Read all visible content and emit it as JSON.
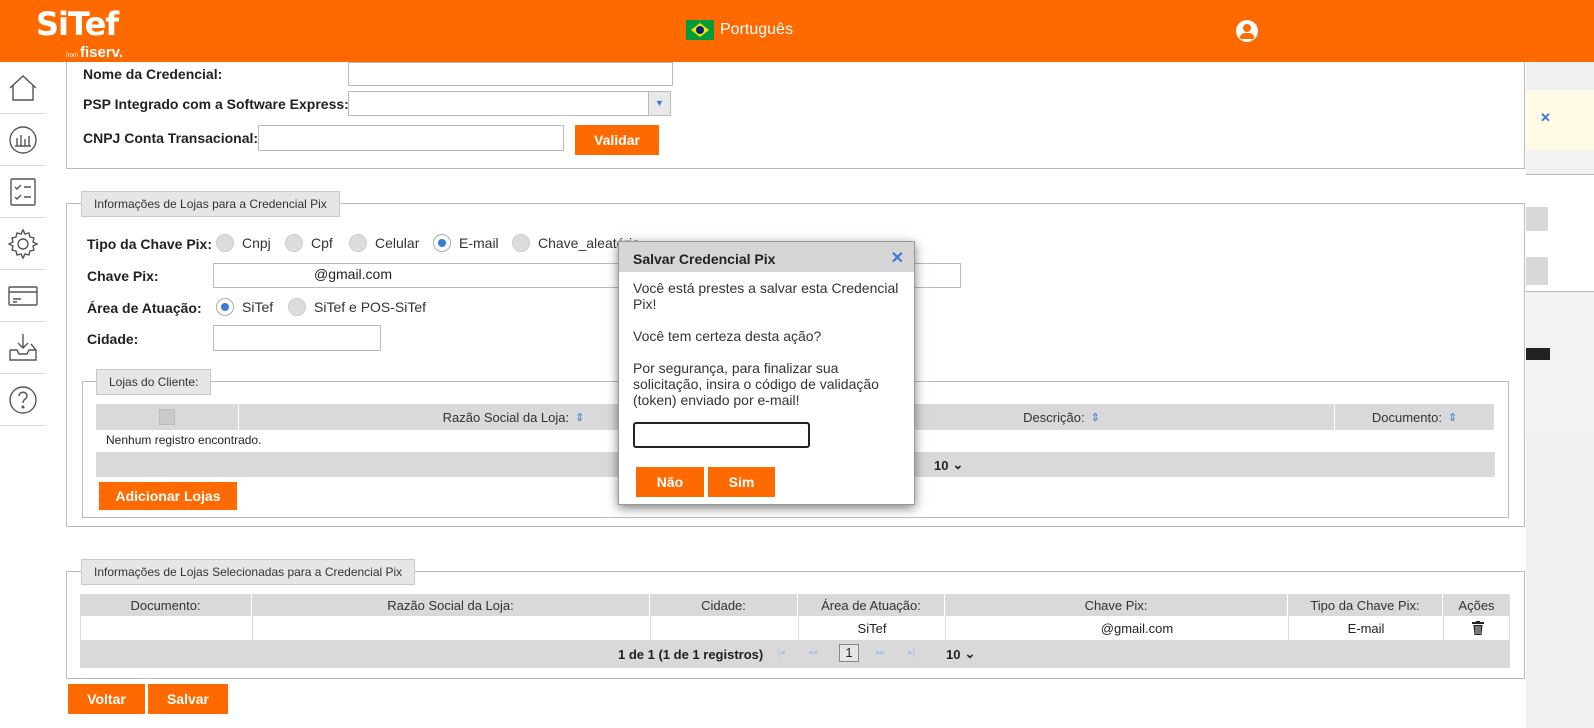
{
  "header": {
    "brand": "SiTef",
    "brand_from": "from",
    "brand_company": "fiserv.",
    "language": "Português"
  },
  "sidebar": {
    "items": [
      "home-icon",
      "chart-icon",
      "checklist-icon",
      "gear-icon",
      "card-icon",
      "download-icon",
      "help-icon"
    ]
  },
  "credential": {
    "name_label": "Nome da Credencial:",
    "psp_label": "PSP Integrado com a Software Express:",
    "cnpj_label": "CNPJ Conta Transacional:",
    "validar_button": "Validar"
  },
  "stores_info": {
    "legend": "Informações de Lojas para a Credencial Pix",
    "key_type_label": "Tipo da Chave Pix:",
    "key_type_options": [
      "Cnpj",
      "Cpf",
      "Celular",
      "E-mail",
      "Chave_aleatória"
    ],
    "key_type_selected": "E-mail",
    "key_label": "Chave Pix:",
    "key_value": "@gmail.com",
    "area_label": "Área de Atuação:",
    "area_options": [
      "SiTef",
      "SiTef e POS-SiTef"
    ],
    "area_selected": "SiTef",
    "city_label": "Cidade:",
    "client_stores": {
      "legend": "Lojas do Cliente:",
      "columns": [
        "Razão Social da Loja:",
        "Descrição:",
        "Documento:"
      ],
      "empty_message": "Nenhum registro encontrado.",
      "page_size": "10",
      "add_button": "Adicionar Lojas"
    }
  },
  "selected_stores": {
    "legend": "Informações de Lojas Selecionadas para a Credencial Pix",
    "columns": [
      "Documento:",
      "Razão Social da Loja:",
      "Cidade:",
      "Área de Atuação:",
      "Chave Pix:",
      "Tipo da Chave Pix:",
      "Ações"
    ],
    "row": {
      "documento": "",
      "razao": "",
      "cidade": "",
      "area": "SiTef",
      "chave": "@gmail.com",
      "tipo": "E-mail"
    },
    "pager_text": "1 de 1 (1 de 1 registros)",
    "current_page": "1",
    "page_size": "10"
  },
  "footer": {
    "back_button": "Voltar",
    "save_button": "Salvar"
  },
  "dialog": {
    "title": "Salvar Credencial Pix",
    "line1": "Você está prestes a salvar esta Credencial Pix!",
    "line2": "Você tem certeza desta ação?",
    "line3": "Por segurança, para finalizar sua solicitação, insira o código de validação (token) enviado por e-mail!",
    "no_button": "Não",
    "yes_button": "Sim"
  },
  "colors": {
    "accent": "#ff6a00",
    "link": "#3a7bd5",
    "grid_header": "#d9d9d9"
  }
}
